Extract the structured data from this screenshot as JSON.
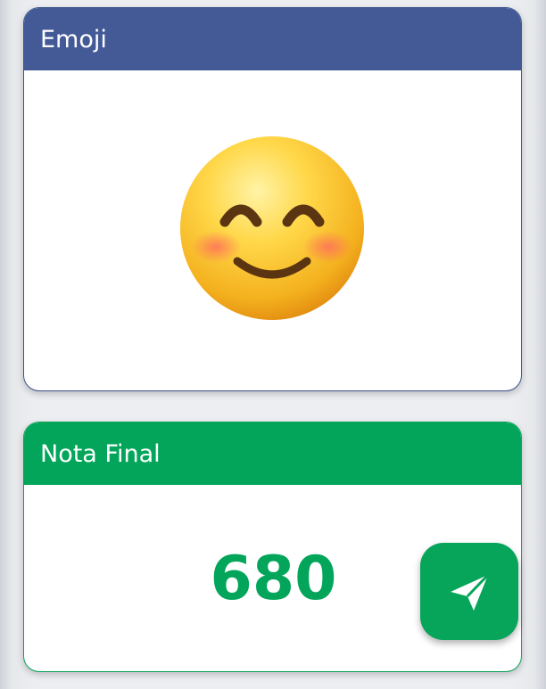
{
  "emoji_card": {
    "title": "Emoji",
    "emoji_icon": "smiling-face-with-smiling-eyes-icon",
    "header_color": "#445a97"
  },
  "score_card": {
    "title": "Nota Final",
    "score": "680",
    "header_color": "#03a55a"
  },
  "send_button": {
    "icon": "paper-plane-icon",
    "color": "#06a55a"
  }
}
